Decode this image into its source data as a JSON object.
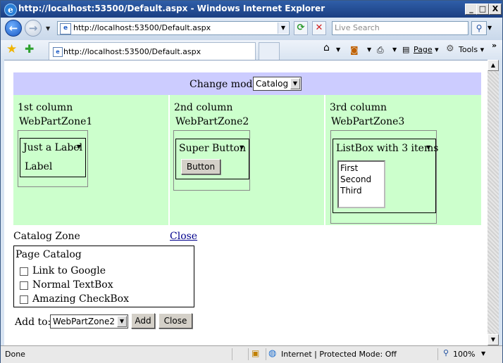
{
  "window": {
    "title": "http://localhost:53500/Default.aspx - Windows Internet Explorer",
    "minimize": "_",
    "maximize": "□",
    "close": "X"
  },
  "navbar": {
    "back_icon": "back-arrow-icon",
    "forward_icon": "forward-arrow-icon",
    "address": "http://localhost:53500/Default.aspx",
    "search_placeholder": "Live Search"
  },
  "tabbar": {
    "tab_title": "http://localhost:53500/Default.aspx",
    "page_label": "Page",
    "tools_label": "Tools",
    "more": "»"
  },
  "page": {
    "mode_label": "Change mode:",
    "mode_value": "Catalog",
    "columns": [
      {
        "heading": "1st column",
        "zone": "WebPartZone1",
        "part_title": "Just a Label",
        "content": "Label"
      },
      {
        "heading": "2nd column",
        "zone": "WebPartZone2",
        "part_title": "Super Button",
        "content": "Button"
      },
      {
        "heading": "3rd column",
        "zone": "WebPartZone3",
        "part_title": "ListBox with 3 items",
        "items": [
          "First",
          "Second",
          "Third"
        ]
      }
    ],
    "catalog": {
      "zone_title": "Catalog Zone",
      "close_link": "Close",
      "page_catalog": "Page Catalog",
      "items": [
        "Link to Google",
        "Normal TextBox",
        "Amazing CheckBox"
      ],
      "add_to_label": "Add to:",
      "add_to_value": "WebPartZone2",
      "add_button": "Add",
      "close_button": "Close"
    }
  },
  "status": {
    "text": "Done",
    "zone": "Internet | Protected Mode: Off",
    "zoom": "100%"
  }
}
